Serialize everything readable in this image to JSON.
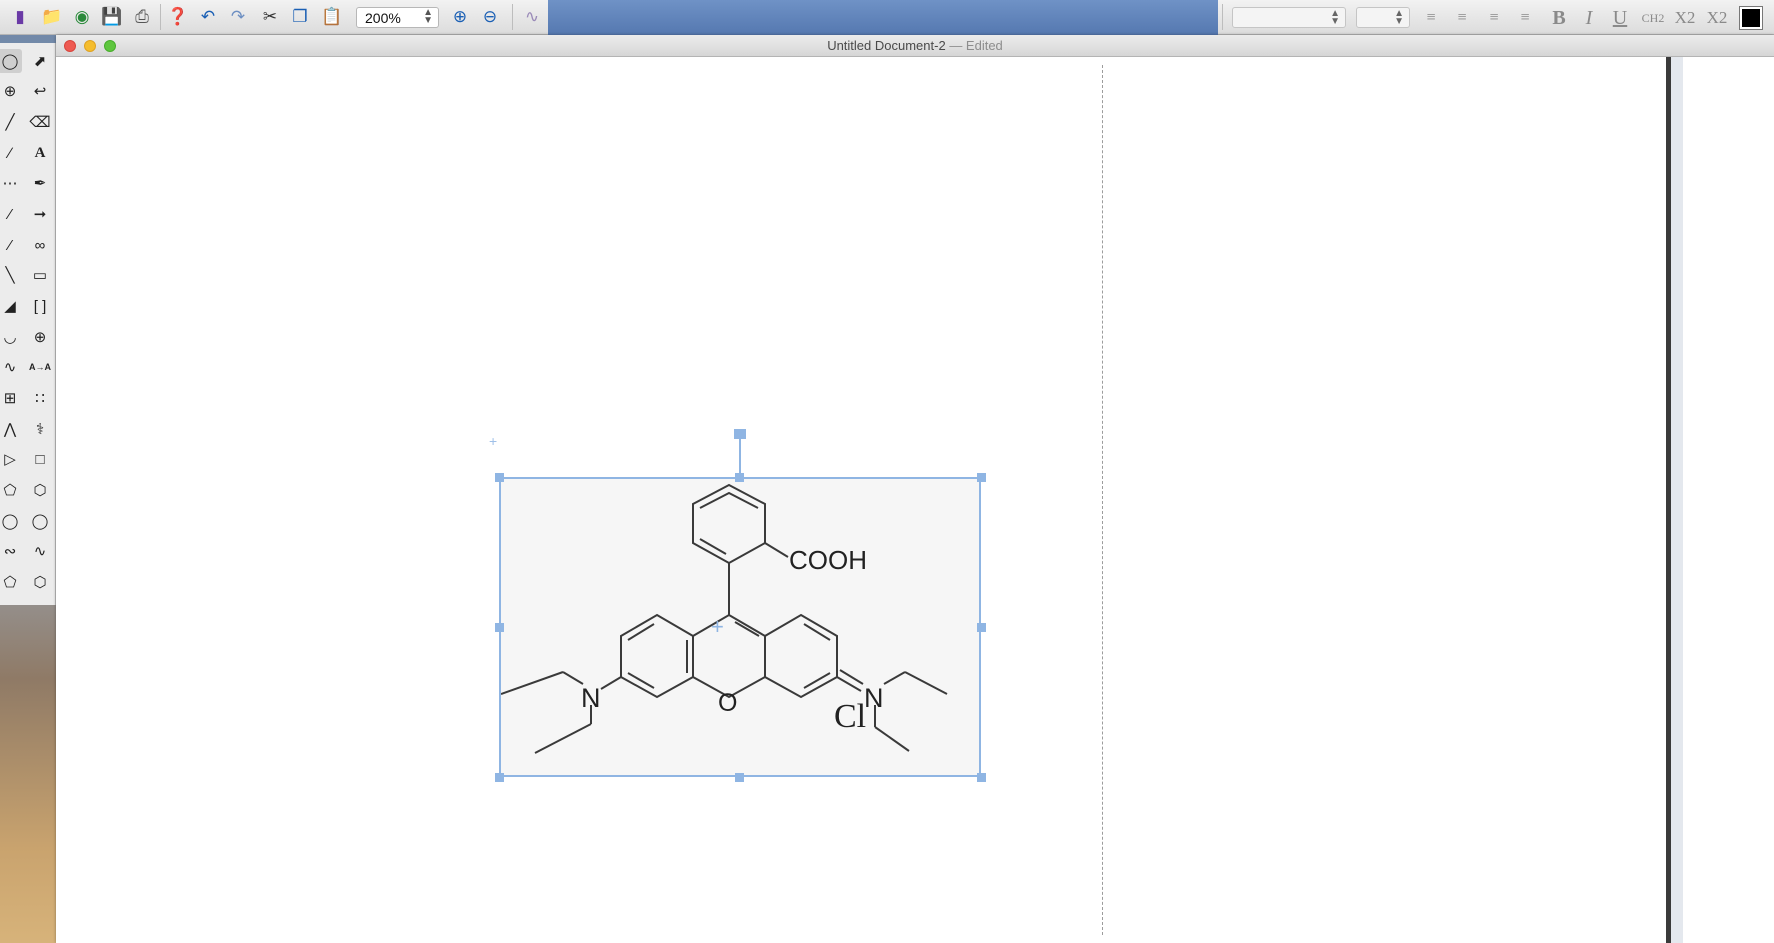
{
  "toolbar": {
    "zoom_value": "200%",
    "font_name": "",
    "font_size": "",
    "format_buttons": {
      "bold": "B",
      "italic": "I",
      "underline": "U",
      "formula": "CH2",
      "subscript": "X2",
      "superscript": "X2"
    },
    "text_color": "#000000"
  },
  "window": {
    "title": "Untitled Document-2",
    "status": "— Edited"
  },
  "structure": {
    "labels": {
      "carboxyl": "COOH",
      "oxygen": "O",
      "nitrogen_left": "N",
      "nitrogen_right": "N",
      "chloride": "Cl"
    }
  },
  "palette": {
    "text_tool": "A",
    "mapping_tool": "A→A"
  },
  "colors": {
    "selection": "#8fb5e3",
    "toolbar_accent": "#5578b0"
  }
}
